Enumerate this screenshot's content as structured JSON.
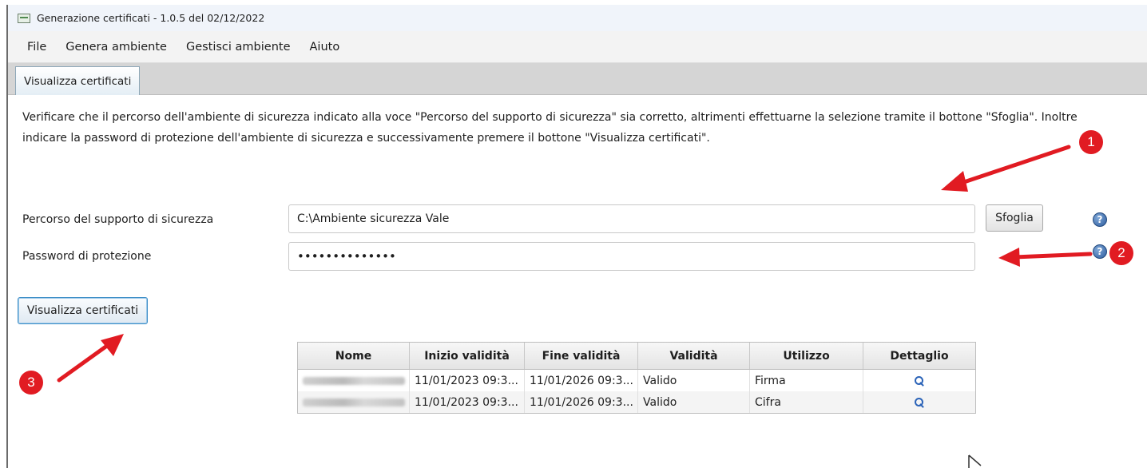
{
  "window": {
    "title": "Generazione certificati - 1.0.5 del 02/12/2022",
    "icon": "app-icon"
  },
  "menu": [
    "File",
    "Genera ambiente",
    "Gestisci ambiente",
    "Aiuto"
  ],
  "tab": {
    "label": "Visualizza certificati"
  },
  "instructions": "Verificare che il percorso dell'ambiente di sicurezza indicato alla voce \"Percorso del supporto di sicurezza\" sia corretto, altrimenti effettuarne la selezione tramite il bottone \"Sfoglia\". Inoltre indicare la password di protezione dell'ambiente di sicurezza e successivamente premere il bottone \"Visualizza certificati\".",
  "form": {
    "path_label": "Percorso del supporto di sicurezza",
    "path_value": "C:\\Ambiente sicurezza Vale",
    "browse_label": "Sfoglia",
    "password_label": "Password di protezione",
    "password_value": "••••••••••••••",
    "help_icon": "question-circle-icon"
  },
  "action_button": "Visualizza certificati",
  "table": {
    "headers": [
      "Nome",
      "Inizio validità",
      "Fine validità",
      "Validità",
      "Utilizzo",
      "Dettaglio"
    ],
    "rows": [
      {
        "nome": "",
        "inizio": "11/01/2023 09:3...",
        "fine": "11/01/2026 09:3...",
        "validita": "Valido",
        "utilizzo": "Firma",
        "dettaglio_icon": "magnifier-icon"
      },
      {
        "nome": "",
        "inizio": "11/01/2023 09:3...",
        "fine": "11/01/2026 09:3...",
        "validita": "Valido",
        "utilizzo": "Cifra",
        "dettaglio_icon": "magnifier-icon"
      }
    ]
  },
  "annotations": {
    "badges": [
      "1",
      "2",
      "3"
    ],
    "color": "#e11b22"
  }
}
